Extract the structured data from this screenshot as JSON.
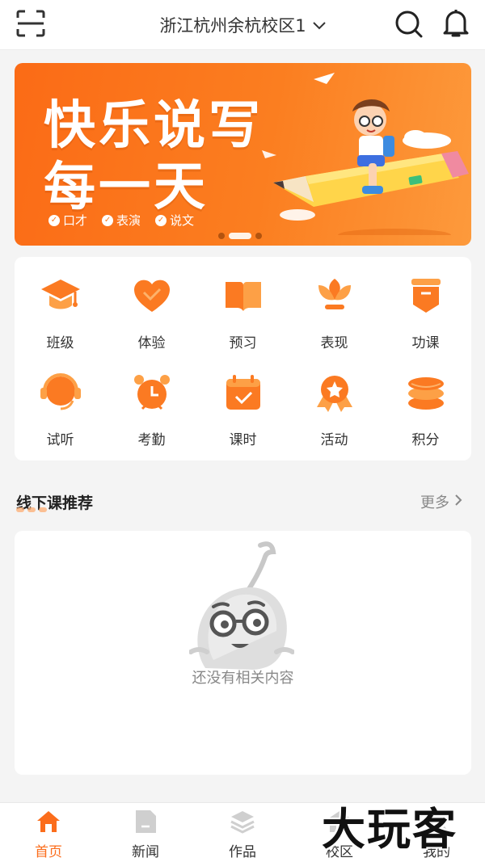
{
  "header": {
    "campus_name": "浙江杭州余杭校区1",
    "icons": [
      "scan-icon",
      "chevron-down-icon",
      "search-icon",
      "bell-icon"
    ]
  },
  "banner": {
    "line1": "快乐说写",
    "line2": "每一天",
    "tags": [
      "口才",
      "表演",
      "说文"
    ],
    "slide_count": 3,
    "active_slide": 2
  },
  "grid": {
    "items": [
      {
        "label": "班级",
        "icon": "graduation-cap-icon"
      },
      {
        "label": "体验",
        "icon": "heart-icon"
      },
      {
        "label": "预习",
        "icon": "book-icon"
      },
      {
        "label": "表现",
        "icon": "lotus-icon"
      },
      {
        "label": "功课",
        "icon": "homework-icon"
      },
      {
        "label": "试听",
        "icon": "headset-icon"
      },
      {
        "label": "考勤",
        "icon": "alarm-clock-icon"
      },
      {
        "label": "课时",
        "icon": "calendar-check-icon"
      },
      {
        "label": "活动",
        "icon": "medal-icon"
      },
      {
        "label": "积分",
        "icon": "coin-stack-icon"
      }
    ]
  },
  "section": {
    "title": "线下课推荐",
    "more_label": "更多"
  },
  "empty_state": {
    "text": "还没有相关内容"
  },
  "tabbar": {
    "tabs": [
      {
        "label": "首页",
        "icon": "home-icon",
        "active": true
      },
      {
        "label": "新闻",
        "icon": "news-icon",
        "active": false
      },
      {
        "label": "作品",
        "icon": "layers-icon",
        "active": false
      },
      {
        "label": "校区",
        "icon": "campus-icon",
        "active": false
      },
      {
        "label": "我的",
        "icon": "profile-icon",
        "active": false
      }
    ]
  },
  "colors": {
    "accent": "#fb6d1c",
    "accent_light": "#fda046",
    "background": "#f4f4f4"
  },
  "watermark": "大玩客"
}
